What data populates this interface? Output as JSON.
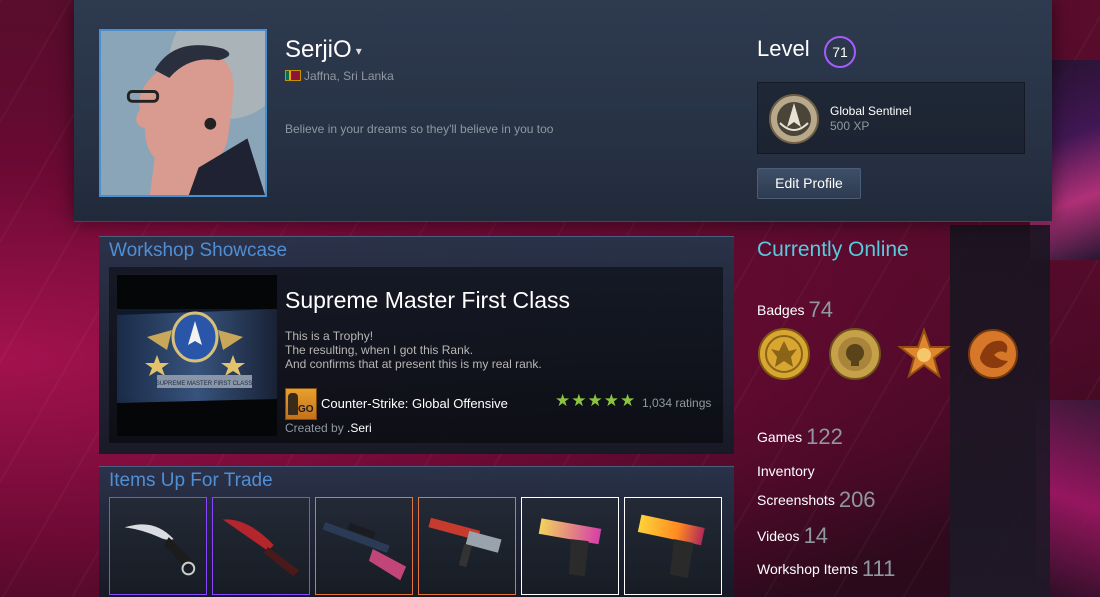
{
  "header": {
    "persona_name": "SerjiO",
    "dropdown_icon": "caret-down-icon",
    "location": "Jaffna, Sri Lanka",
    "summary": "Believe in your dreams so they'll believe in you too",
    "level_label": "Level",
    "level_value": "71",
    "favorite_badge": {
      "name": "Global Sentinel",
      "xp": "500 XP"
    },
    "edit_profile_label": "Edit Profile"
  },
  "workshop": {
    "section_title": "Workshop Showcase",
    "item_title": "Supreme Master First Class",
    "description_lines": [
      "This is a Trophy!",
      "The resulting, when I got this Rank.",
      "And confirms that at present this is my real rank."
    ],
    "game_name": "Counter-Strike: Global Offensive",
    "game_icon_text": "GO",
    "stars": "★★★★★",
    "ratings": "1,034 ratings",
    "created_by_label": "Created by",
    "creator": ".Seri",
    "preview_banner_text": "SUPREME MASTER FIRST CLASS"
  },
  "trade": {
    "section_title": "Items Up For Trade",
    "items": [
      {
        "name": "karambit-knife",
        "border": "#8847ff"
      },
      {
        "name": "huntsman-knife",
        "border": "#8847ff"
      },
      {
        "name": "awp-rifle",
        "border": "#e4743a"
      },
      {
        "name": "m4a4-rifle",
        "border": "#e4743a"
      },
      {
        "name": "desert-eagle-pistol",
        "border": "#ffffff"
      },
      {
        "name": "desert-eagle-blaze-pistol",
        "border": "#ffffff"
      }
    ]
  },
  "sidebar": {
    "status": "Currently Online",
    "badges_label": "Badges",
    "badges_count": "74",
    "badges": [
      "eagle-coin-icon",
      "skull-coin-icon",
      "star-badge-icon",
      "dragon-badge-icon"
    ],
    "games_label": "Games",
    "games_count": "122",
    "inventory_label": "Inventory",
    "screenshots_label": "Screenshots",
    "screenshots_count": "206",
    "videos_label": "Videos",
    "videos_count": "14",
    "workshop_items_label": "Workshop Items",
    "workshop_items_count": "111"
  },
  "colors": {
    "accent_blue": "#4f8fd4",
    "online_cyan": "#57cbde",
    "level_purple": "#a55cff",
    "stars_green": "#8bc53f"
  }
}
